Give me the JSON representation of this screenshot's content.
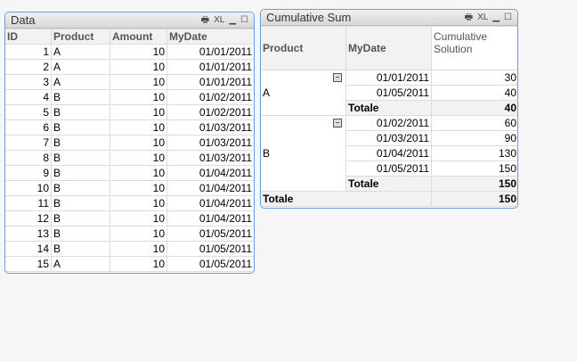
{
  "data_box": {
    "title": "Data",
    "tools": [
      "print-icon",
      "XL",
      "_",
      "□"
    ],
    "headers": [
      "ID",
      "Product",
      "Amount",
      "MyDate"
    ],
    "rows": [
      [
        "1",
        "A",
        "10",
        "01/01/2011"
      ],
      [
        "2",
        "A",
        "10",
        "01/01/2011"
      ],
      [
        "3",
        "A",
        "10",
        "01/01/2011"
      ],
      [
        "4",
        "B",
        "10",
        "01/02/2011"
      ],
      [
        "5",
        "B",
        "10",
        "01/02/2011"
      ],
      [
        "6",
        "B",
        "10",
        "01/03/2011"
      ],
      [
        "7",
        "B",
        "10",
        "01/03/2011"
      ],
      [
        "8",
        "B",
        "10",
        "01/03/2011"
      ],
      [
        "9",
        "B",
        "10",
        "01/04/2011"
      ],
      [
        "10",
        "B",
        "10",
        "01/04/2011"
      ],
      [
        "11",
        "B",
        "10",
        "01/04/2011"
      ],
      [
        "12",
        "B",
        "10",
        "01/04/2011"
      ],
      [
        "13",
        "B",
        "10",
        "01/05/2011"
      ],
      [
        "14",
        "B",
        "10",
        "01/05/2011"
      ],
      [
        "15",
        "A",
        "10",
        "01/05/2011"
      ]
    ]
  },
  "cum_box": {
    "title": "Cumulative Sum",
    "headers": [
      "Product",
      "MyDate",
      "Cumulative Solution"
    ],
    "groups": [
      {
        "product": "A",
        "rows": [
          [
            "01/01/2011",
            "30"
          ],
          [
            "01/05/2011",
            "40"
          ]
        ],
        "total_label": "Totale",
        "total": "40"
      },
      {
        "product": "B",
        "rows": [
          [
            "01/02/2011",
            "60"
          ],
          [
            "01/03/2011",
            "90"
          ],
          [
            "01/04/2011",
            "130"
          ],
          [
            "01/05/2011",
            "150"
          ]
        ],
        "total_label": "Totale",
        "total": "150"
      }
    ],
    "grand_label": "Totale",
    "grand_total": "150"
  }
}
